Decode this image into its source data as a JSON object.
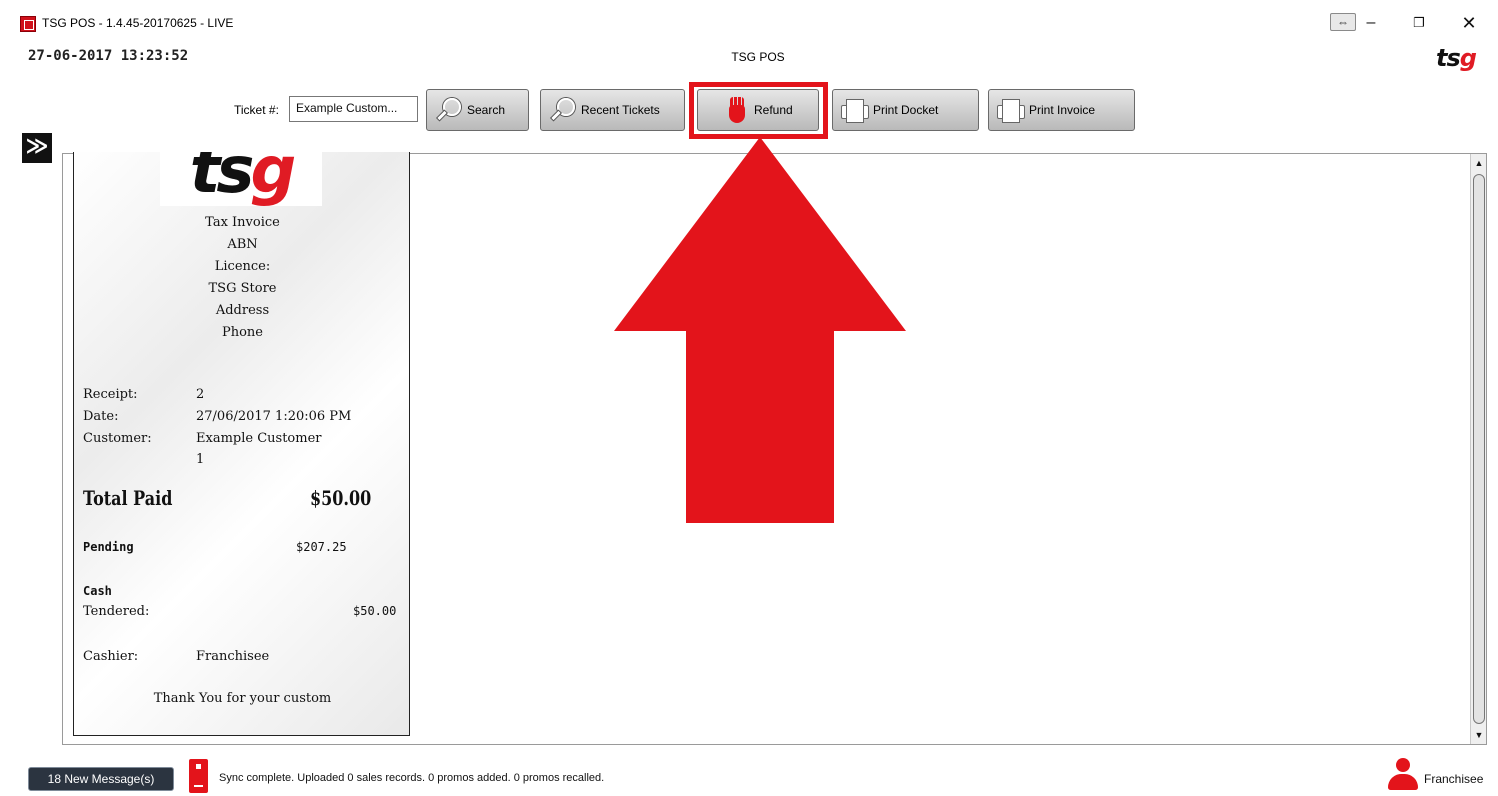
{
  "window": {
    "title": "TSG POS - 1.4.45-20170625 - LIVE",
    "resize_toggle": "⇔",
    "minimize": "–",
    "restore": "❐",
    "close": "✕"
  },
  "header": {
    "datetime": "27-06-2017 13:23:52",
    "title": "TSG POS",
    "logo_ts": "ts",
    "logo_g": "g"
  },
  "toolbar": {
    "ticket_label": "Ticket #:",
    "ticket_value": "Example Custom...",
    "search_label": "Search",
    "recent_tickets_label": "Recent Tickets",
    "refund_label": "Refund",
    "print_docket_label": "Print Docket",
    "print_invoice_label": "Print Invoice"
  },
  "sidebar": {
    "toggle": "≫"
  },
  "receipt": {
    "logo_ts": "ts",
    "logo_g": "g",
    "header_lines": [
      "Tax Invoice",
      "ABN",
      "Licence:",
      "TSG Store",
      "Address",
      "Phone"
    ],
    "receipt_label": "Receipt:",
    "receipt_value": "2",
    "date_label": "Date:",
    "date_value": "27/06/2017 1:20:06 PM",
    "customer_label": "Customer:",
    "customer_value": "Example Customer",
    "customer_number": "1",
    "total_paid_label": "Total Paid",
    "total_paid_value": "$50.00",
    "pending_label": "Pending",
    "pending_value": "$207.25",
    "payment_method": "Cash",
    "tendered_label": "Tendered:",
    "tendered_value": "$50.00",
    "cashier_label": "Cashier:",
    "cashier_value": "Franchisee",
    "footer": "Thank You for your custom"
  },
  "status_bar": {
    "messages": "18 New Message(s)",
    "sync_status": "Sync complete.  Uploaded 0 sales records. 0 promos added. 0 promos recalled.",
    "user": "Franchisee"
  },
  "colors": {
    "accent_red": "#e3141b",
    "brand_black": "#111111"
  },
  "icons": [
    "app-icon",
    "magnifier-icon",
    "hand-stop-icon",
    "printer-icon",
    "sync-icon",
    "user-icon",
    "up-arrow-annotation"
  ]
}
